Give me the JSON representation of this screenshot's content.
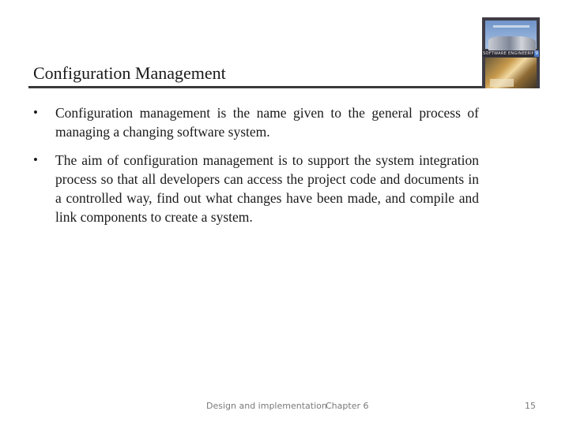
{
  "slide": {
    "title": "Configuration Management",
    "bullets": [
      {
        "marker": "•",
        "text": "Configuration management is the name given to the general process of managing a changing software system."
      },
      {
        "marker": "•",
        "text": "The aim of configuration management is to support the system integration process so that all developers can access the project code and documents in a controlled way, find out what changes have been made, and compile and link components to create a system."
      }
    ],
    "cover_image": {
      "icon": "book-cover-image",
      "band_text": "SOFTWARE ENGINEERING",
      "edition": "9"
    }
  },
  "footer": {
    "left": "Design and implementation",
    "chapter": "Chapter 6",
    "page_number": "15"
  },
  "colors": {
    "title_rule": "#3a3a3d",
    "text": "#1a1a1a",
    "footer_text": "#7a7a7a"
  }
}
